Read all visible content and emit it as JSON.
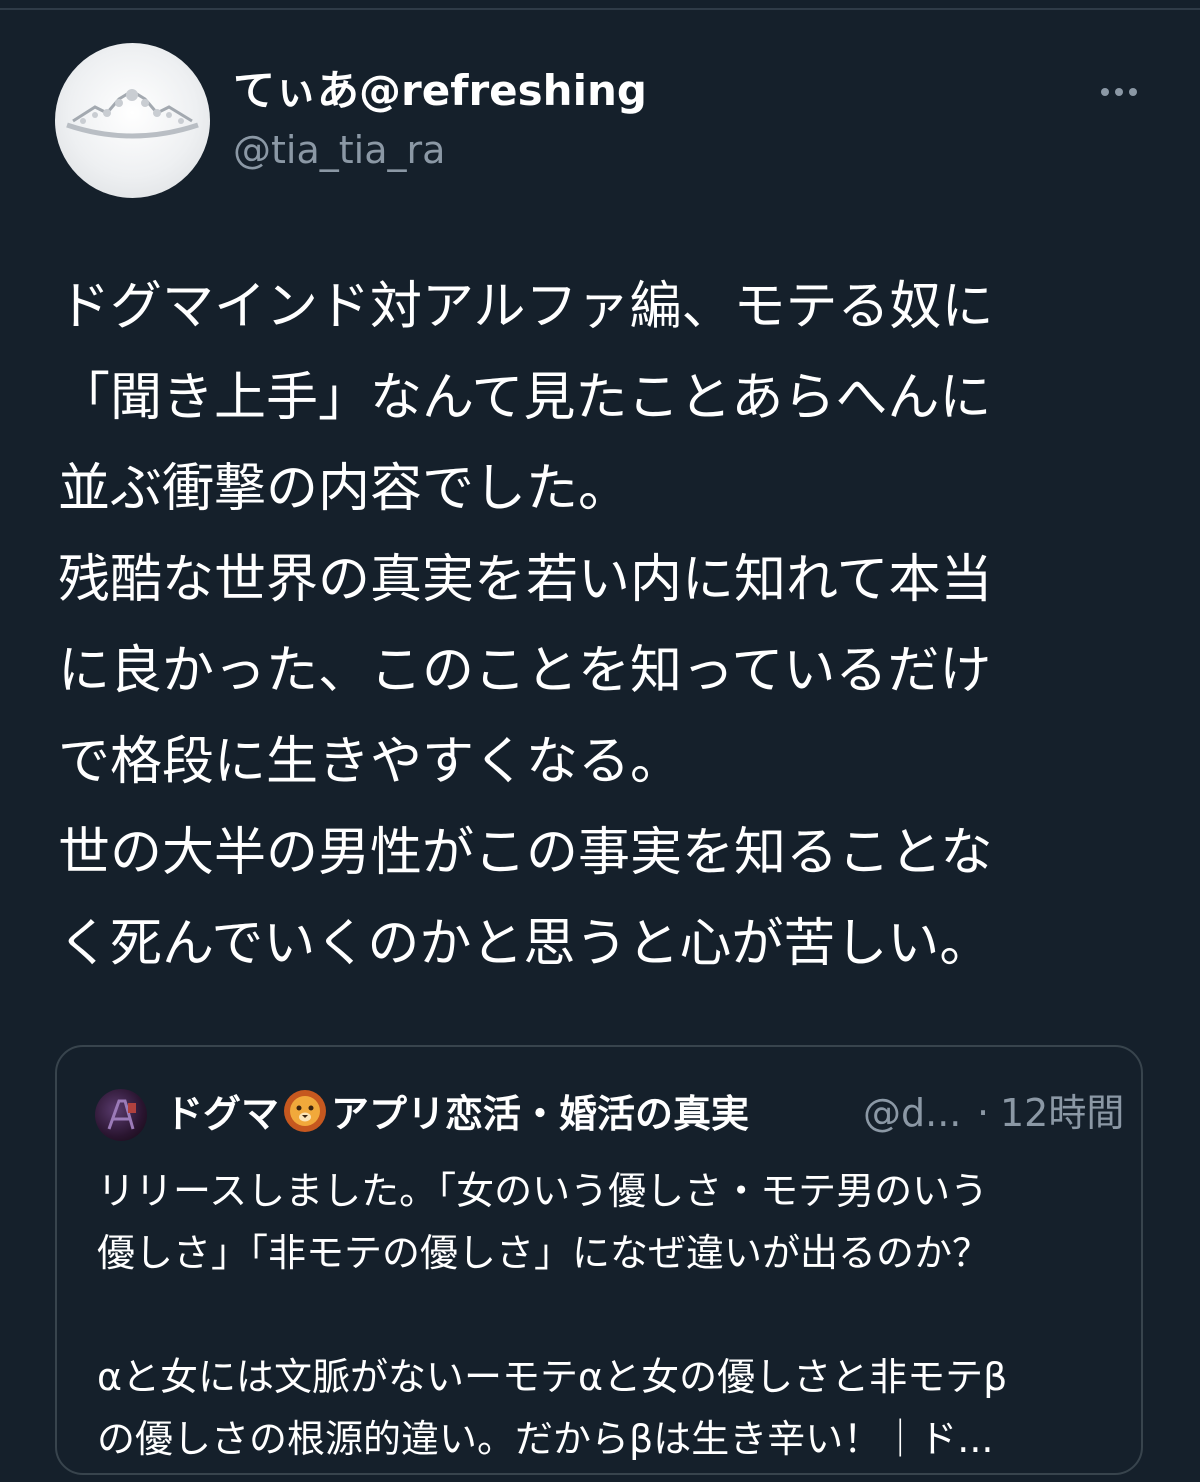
{
  "author": {
    "display_name": "てぃあ@refreshing",
    "handle": "@tia_tia_ra",
    "avatar_icon": "tiara-avatar-icon"
  },
  "more_icon": "more-horizontal-icon",
  "tweet": {
    "lines": [
      "ドグマインド対アルファ編、モテる奴に",
      "「聞き上手」なんて見たことあらへんに",
      "並ぶ衝撃の内容でした。",
      "残酷な世界の真実を若い内に知れて本当",
      "に良かった、このことを知っているだけ",
      "で格段に生きやすくなる。",
      "世の大半の男性がこの事実を知ることな",
      "く死んでいくのかと思うと心が苦しい。"
    ]
  },
  "quote": {
    "name_part1": "ドグマ",
    "name_icon": "lion-emoji-icon",
    "name_part2": "アプリ恋活・婚活の真実",
    "handle": "@d...",
    "separator": "·",
    "time": "12時間",
    "lines": [
      "リリースしました。「女のいう優しさ・モテ男のいう",
      "優しさ」「非モテの優しさ」になぜ違いが出るのか？",
      "",
      "αと女には文脈がないーモテαと女の優しさと非モテβ",
      "の優しさの根源的違い。だからβは生き辛い！｜ド..."
    ]
  },
  "colors": {
    "background": "#15202b",
    "text_primary": "#ffffff",
    "text_secondary": "#8b98a5",
    "border": "#38444d"
  }
}
